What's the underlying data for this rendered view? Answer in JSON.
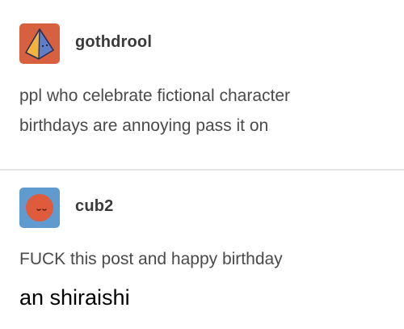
{
  "posts": [
    {
      "avatar_icon": "pyramid-icon",
      "avatar_bg": "#d7603f",
      "username": "gothdrool",
      "body_lines": [
        "ppl who celebrate fictional character",
        "birthdays are annoying pass it on"
      ]
    },
    {
      "avatar_icon": "moon-icon",
      "avatar_bg": "#5f9bcf",
      "username": "cub2",
      "body_lines": [
        "FUCK this post and happy birthday"
      ],
      "caption": "an shiraishi"
    }
  ],
  "colors": {
    "username": "#3a3a3a",
    "body_text": "#4a4a4a",
    "divider": "#e4e4e4",
    "caption": "#000000"
  }
}
